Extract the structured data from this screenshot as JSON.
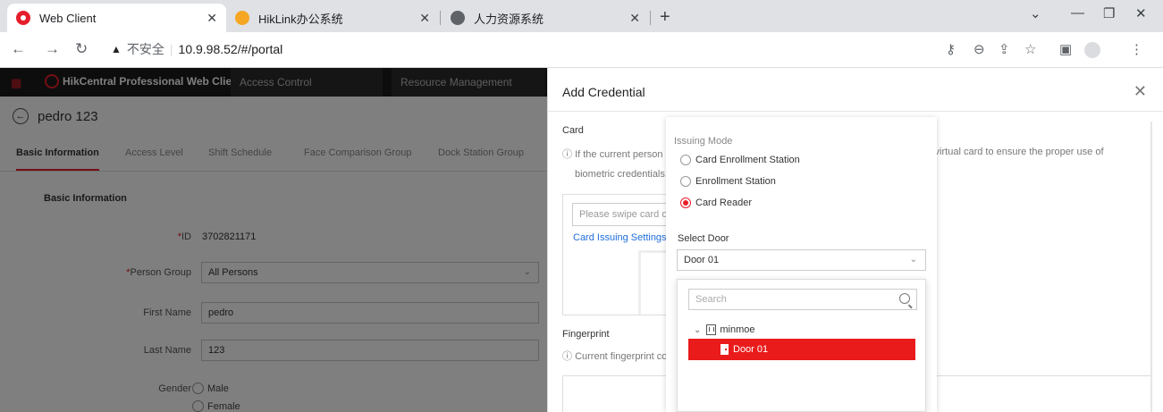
{
  "browser": {
    "tabs": [
      {
        "title": "Web Client",
        "icon": "hik-icon",
        "active": true
      },
      {
        "title": "HikLink办公系统",
        "icon": "hiklink-icon",
        "active": false
      },
      {
        "title": "人力资源系统",
        "icon": "globe-icon",
        "active": false
      }
    ],
    "new_tab": "+",
    "url_security": "不安全",
    "url": "10.9.98.52/#/portal"
  },
  "app": {
    "brand": "HikCentral Professional Web Client",
    "nav": [
      "Access Control",
      "Resource Management"
    ],
    "person_name": "pedro 123",
    "subtabs": [
      "Basic Information",
      "Access Level",
      "Shift Schedule",
      "Face Comparison Group",
      "Dock Station Group"
    ],
    "section_title": "Basic Information",
    "fields": {
      "id_label": "ID",
      "id_value": "3702821171",
      "group_label": "Person Group",
      "group_value": "All Persons",
      "first_name_label": "First Name",
      "first_name_value": "pedro",
      "last_name_label": "Last Name",
      "last_name_value": "123",
      "gender_label": "Gender",
      "gender_male": "Male",
      "gender_female": "Female"
    }
  },
  "drawer": {
    "title": "Add Credential",
    "card_label": "Card",
    "card_note_a": "If the current person",
    "card_note_b": "it virtual card to ensure the proper use of",
    "card_note_c": "biometric credentials.",
    "card_input_placeholder": "Please swipe card or",
    "card_issuing_settings": "Card Issuing Settings",
    "fingerprint_label": "Fingerprint",
    "fingerprint_note": "Current fingerprint colle"
  },
  "issuing": {
    "title": "Issuing Mode",
    "modes": [
      "Card Enrollment Station",
      "Enrollment Station",
      "Card Reader"
    ],
    "selected_mode_index": 2,
    "select_door_label": "Select Door",
    "selected_door": "Door 01",
    "search_placeholder": "Search",
    "tree_root": "minmoe",
    "tree_door": "Door 01"
  },
  "colors": {
    "accent": "#e61e2b",
    "selected_bg": "#ea1b1b",
    "link": "#1e6fd9"
  }
}
